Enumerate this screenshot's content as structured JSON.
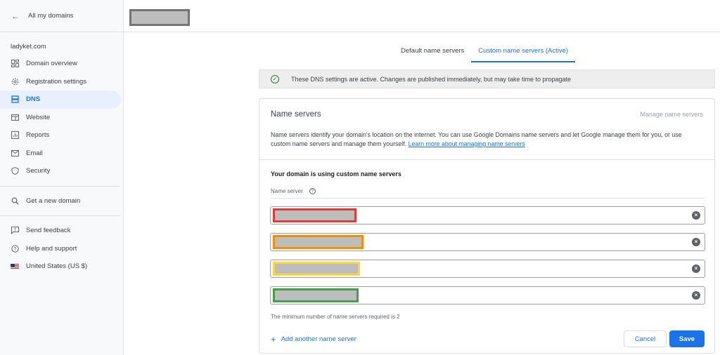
{
  "sidebar": {
    "back_label": "All my domains",
    "domain": "ladyket.com",
    "items": [
      {
        "label": "Domain overview",
        "icon": "dashboard-icon"
      },
      {
        "label": "Registration settings",
        "icon": "gear-icon"
      },
      {
        "label": "DNS",
        "icon": "dns-icon",
        "active": true
      },
      {
        "label": "Website",
        "icon": "website-icon"
      },
      {
        "label": "Reports",
        "icon": "chart-icon"
      },
      {
        "label": "Email",
        "icon": "mail-icon"
      },
      {
        "label": "Security",
        "icon": "shield-icon"
      }
    ],
    "get_domain": "Get a new domain",
    "feedback": "Send feedback",
    "help": "Help and support",
    "region": "United States (US $)"
  },
  "tabs": {
    "default": "Default name servers",
    "custom": "Custom name servers (Active)"
  },
  "banner": {
    "text": "These DNS settings are active. Changes are published immediately, but may take time to propagate"
  },
  "card": {
    "title": "Name servers",
    "manage_link": "Manage name servers",
    "description": "Name servers identify your domain's location on the internet. You can use Google Domains name servers and let Google manage them for you, or use custom name servers and manage them yourself.",
    "learn_more": "Learn more about managing name servers",
    "using_title": "Your domain is using custom name servers",
    "ns_label": "Name server",
    "min_note": "The minimum number of name servers required is 2",
    "add_label": "Add another name server",
    "cancel": "Cancel",
    "save": "Save"
  },
  "colors": {
    "accent": "#1a73e8",
    "success": "#188038",
    "highlight_1": "#e53935",
    "highlight_2": "#fb8c00",
    "highlight_3": "#fdd835",
    "highlight_4": "#43a047"
  }
}
